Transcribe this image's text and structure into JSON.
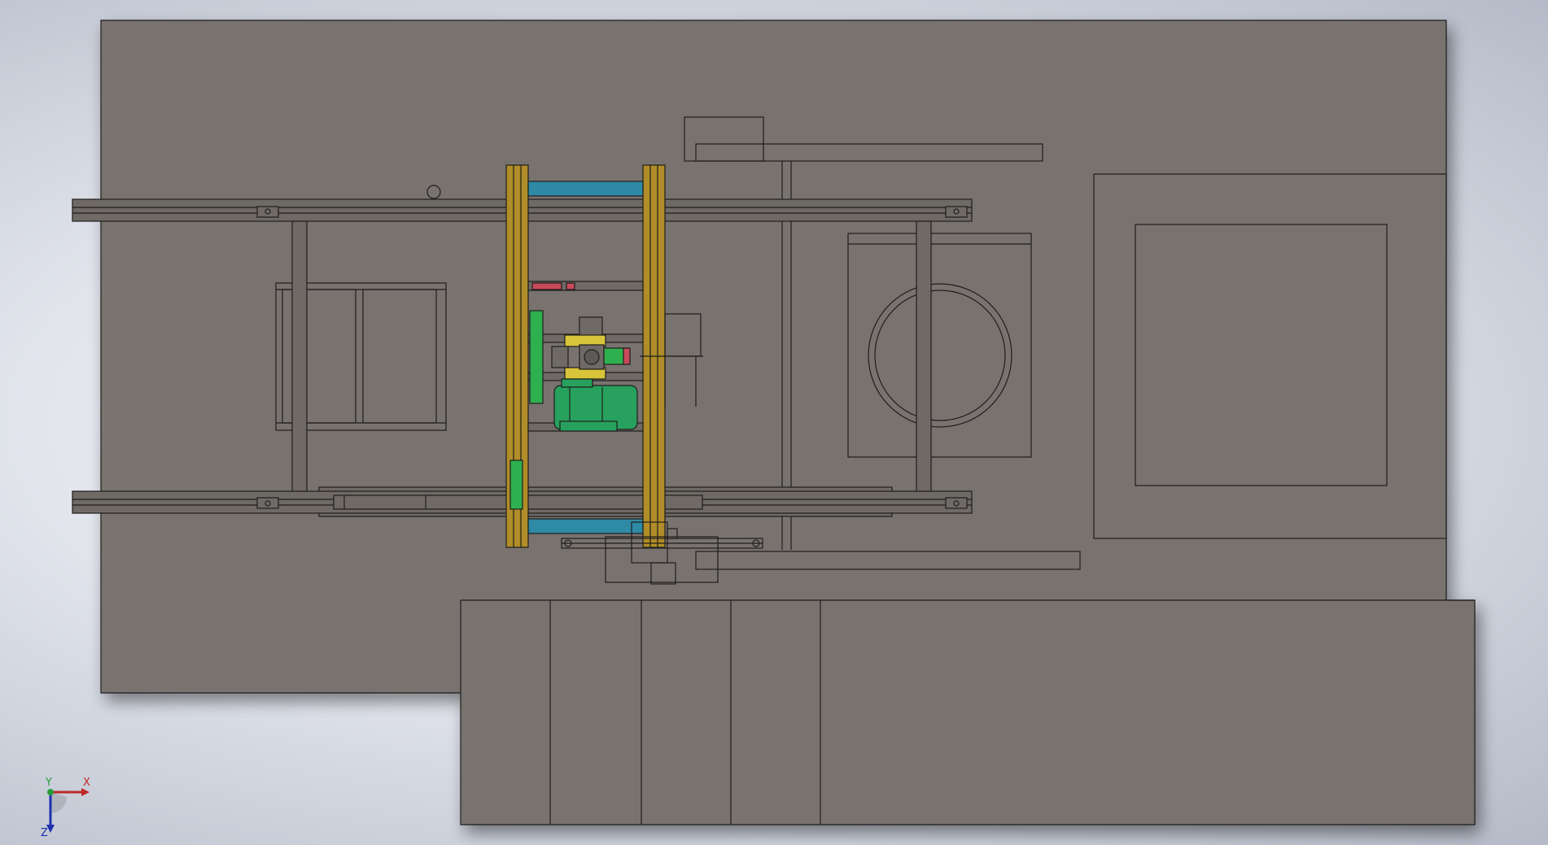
{
  "app": {
    "view": "cad-top-view"
  },
  "colors": {
    "body": "#79736f",
    "line": "#1f1d1c",
    "rail": "#6f6a66",
    "yellow_frame": "#b08d28",
    "blue_bar": "#2e8aa5",
    "green_motor": "#27a15d",
    "green_part": "#2fb04f",
    "red_part": "#c84a5a",
    "yellow_part": "#d7c43a",
    "axis_x": "#c0282a",
    "axis_y": "#2a9d3a",
    "axis_z": "#1e2fb0"
  },
  "triad": {
    "x_label": "X",
    "y_label": "Y",
    "z_label": "Z"
  }
}
